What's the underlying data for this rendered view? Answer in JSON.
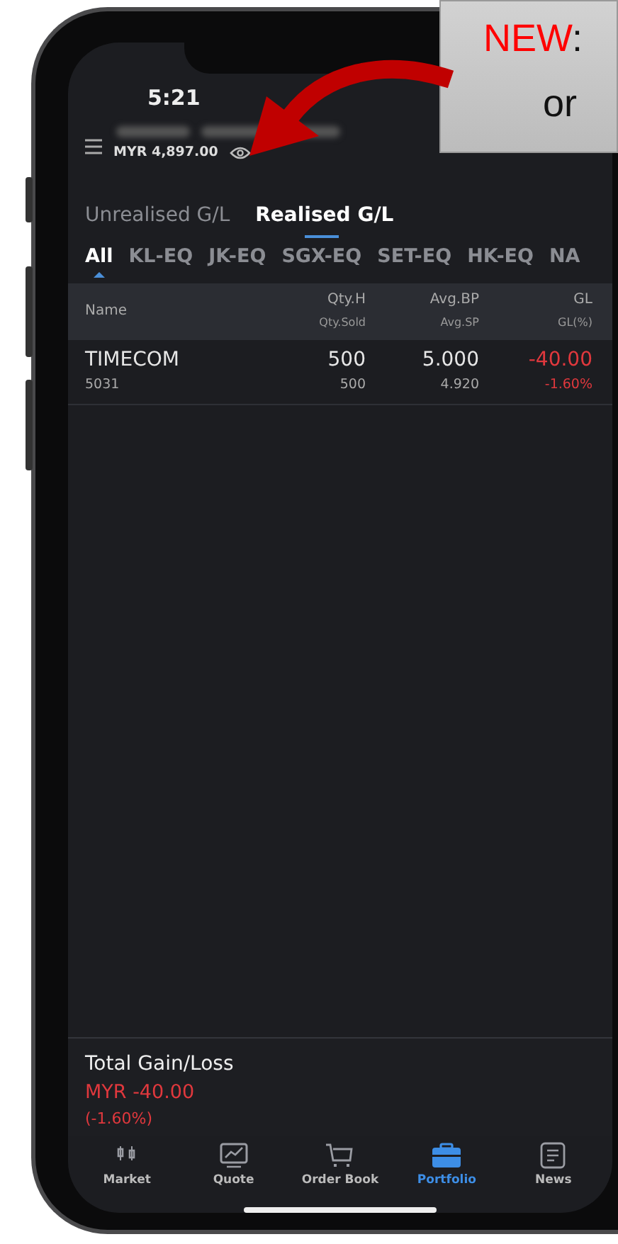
{
  "status_bar": {
    "time": "5:21"
  },
  "account": {
    "balance": "MYR 4,897.00"
  },
  "tabs": [
    {
      "label": "Unrealised G/L",
      "selected": false
    },
    {
      "label": "Realised G/L",
      "selected": true
    }
  ],
  "markets": [
    {
      "label": "All",
      "selected": true
    },
    {
      "label": "KL-EQ",
      "selected": false
    },
    {
      "label": "JK-EQ",
      "selected": false
    },
    {
      "label": "SGX-EQ",
      "selected": false
    },
    {
      "label": "SET-EQ",
      "selected": false
    },
    {
      "label": "HK-EQ",
      "selected": false
    },
    {
      "label": "NA",
      "selected": false
    }
  ],
  "table": {
    "columns": [
      {
        "top": "Name"
      },
      {
        "top": "Qty.H",
        "bottom": "Qty.Sold"
      },
      {
        "top": "Avg.BP",
        "bottom": "Avg.SP"
      },
      {
        "top": "GL",
        "bottom": "GL(%)"
      }
    ],
    "rows": [
      {
        "name": "TIMECOM",
        "code": "5031",
        "qty_held": "500",
        "qty_sold": "500",
        "avg_bp": "5.000",
        "avg_sp": "4.920",
        "gl": "-40.00",
        "gl_pct": "-1.60%",
        "loss": true
      }
    ]
  },
  "summary": {
    "title": "Total Gain/Loss",
    "amount": "MYR -40.00",
    "percent": "(-1.60%)",
    "loss": true
  },
  "nav": [
    {
      "label": "Market",
      "kind": "market",
      "selected": false
    },
    {
      "label": "Quote",
      "kind": "quote",
      "selected": false
    },
    {
      "label": "Order Book",
      "kind": "cart",
      "selected": false
    },
    {
      "label": "Portfolio",
      "kind": "briefcase",
      "selected": true
    },
    {
      "label": "News",
      "kind": "news",
      "selected": false
    }
  ],
  "callout": {
    "highlight": "NEW",
    "rest": ":",
    "line_2": "or"
  }
}
